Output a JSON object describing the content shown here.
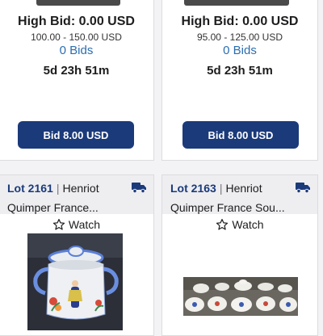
{
  "cards": [
    {
      "high_bid": "High Bid: 0.00 USD",
      "estimate": "100.00 - 150.00 USD",
      "bids": "0 Bids",
      "time_left": "5d 23h 51m",
      "bid_button": "Bid 8.00 USD"
    },
    {
      "high_bid": "High Bid: 0.00 USD",
      "estimate": "95.00 - 125.00 USD",
      "bids": "0 Bids",
      "time_left": "5d 23h 51m",
      "bid_button": "Bid 8.00 USD"
    },
    {
      "lot": "Lot 2161",
      "separator": "|",
      "maker": "Henriot",
      "title": "Quimper France...",
      "watch": "Watch",
      "shipping_icon": "truck-icon",
      "watch_icon": "star-outline-icon"
    },
    {
      "lot": "Lot 2163",
      "separator": "|",
      "maker": "Henriot",
      "title": "Quimper France Sou...",
      "watch": "Watch",
      "shipping_icon": "truck-icon",
      "watch_icon": "star-outline-icon"
    }
  ],
  "colors": {
    "brand_navy": "#1b3a7a",
    "link_blue": "#2c6db0",
    "header_bg": "#eeeef1"
  }
}
